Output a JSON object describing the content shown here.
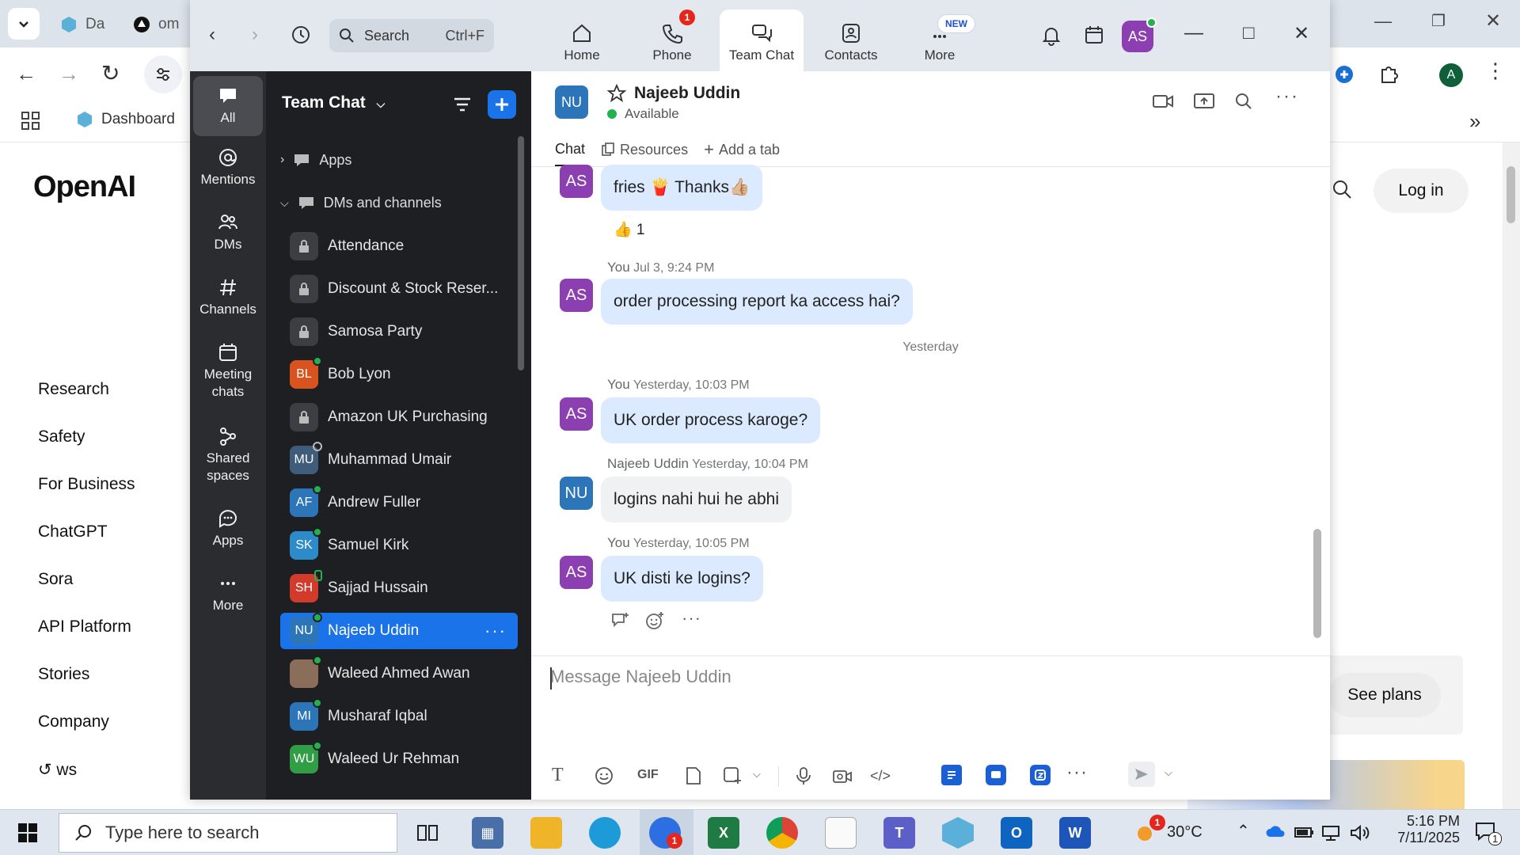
{
  "browser": {
    "tabs": [
      {
        "label": "Da"
      },
      {
        "label": "om"
      }
    ],
    "bookmarks": {
      "dashboard": "Dashboard"
    },
    "profile_initial": "A",
    "page": {
      "logo": "OpenAI",
      "nav": [
        "Research",
        "Safety",
        "For Business",
        "ChatGPT",
        "Sora",
        "API Platform",
        "Stories",
        "Company",
        "↺ ​​ws"
      ],
      "login": "Log in",
      "see_plans": "See plans"
    }
  },
  "zoom": {
    "search": {
      "placeholder": "Search",
      "shortcut": "Ctrl+F"
    },
    "tabs": [
      {
        "label": "Home",
        "icon": "home-icon"
      },
      {
        "label": "Phone",
        "icon": "phone-icon",
        "badge": "1"
      },
      {
        "label": "Team Chat",
        "icon": "chat-icon",
        "active": true
      },
      {
        "label": "Contacts",
        "icon": "contacts-icon"
      },
      {
        "label": "More",
        "icon": "more-icon",
        "badge": "NEW"
      }
    ],
    "user_initials": "AS",
    "rail": [
      {
        "label": "All",
        "icon": "chat-bubble-icon"
      },
      {
        "label": "Mentions",
        "icon": "at-icon"
      },
      {
        "label": "DMs",
        "icon": "people-icon"
      },
      {
        "label": "Channels",
        "icon": "hash-icon"
      },
      {
        "label": "Meeting chats",
        "icon": "calendar-icon"
      },
      {
        "label": "Shared spaces",
        "icon": "shared-spaces-icon"
      },
      {
        "label": "Apps",
        "icon": "apps-icon"
      },
      {
        "label": "More",
        "icon": "ellipsis-icon"
      }
    ],
    "channel_list": {
      "title": "Team Chat",
      "sections": {
        "apps": "Apps",
        "dms": "DMs and channels"
      },
      "items": [
        {
          "name": "Attendance",
          "type": "lock"
        },
        {
          "name": "Discount & Stock Reser...",
          "type": "lock"
        },
        {
          "name": "Samosa Party",
          "type": "lock"
        },
        {
          "name": "Bob Lyon",
          "initials": "BL",
          "color": "#d9531e",
          "status": "online"
        },
        {
          "name": "Amazon UK Purchasing",
          "type": "lock"
        },
        {
          "name": "Muhammad Umair",
          "initials": "MU",
          "color": "#3f5c7a",
          "status": "away"
        },
        {
          "name": "Andrew Fuller",
          "initials": "AF",
          "color": "#2d75b9",
          "status": "online"
        },
        {
          "name": "Samuel Kirk",
          "initials": "SK",
          "color": "#2d8bc9",
          "status": "online"
        },
        {
          "name": "Sajjad Hussain",
          "initials": "SH",
          "color": "#d23a2c",
          "status": "mobile"
        },
        {
          "name": "Najeeb Uddin",
          "initials": "NU",
          "color": "#2d75b9",
          "status": "online",
          "active": true
        },
        {
          "name": "Waleed Ahmed Awan",
          "initials": "",
          "color": "#8a6e5a",
          "status": "online"
        },
        {
          "name": "Musharaf Iqbal",
          "initials": "MI",
          "color": "#2d75b9",
          "status": "online"
        },
        {
          "name": "Waleed Ur Rehman",
          "initials": "WU",
          "color": "#2f9e44",
          "status": "online"
        }
      ]
    },
    "chat": {
      "contact_name": "Najeeb Uddin",
      "contact_initials": "NU",
      "status": "Available",
      "tabs": [
        "Chat",
        "Resources",
        "Add a tab"
      ],
      "day_separator": "Yesterday",
      "messages": [
        {
          "from": "AS",
          "text": "fries 🍟 Thanks👍🏼",
          "reaction": "👍 1"
        },
        {
          "from": "AS",
          "sender": "You",
          "time": "Jul 3, 9:24 PM",
          "text": "order processing report ka access hai?"
        },
        {
          "from": "AS",
          "sender": "You",
          "time": "Yesterday, 10:03 PM",
          "text": "UK order process karoge?"
        },
        {
          "from": "NU",
          "sender": "Najeeb Uddin",
          "time": "Yesterday, 10:04 PM",
          "text": "logins nahi hui he abhi"
        },
        {
          "from": "AS",
          "sender": "You",
          "time": "Yesterday, 10:05 PM",
          "text": "UK disti ke logins?"
        }
      ],
      "composer_placeholder": "Message Najeeb Uddin"
    }
  },
  "taskbar": {
    "search_placeholder": "Type here to search",
    "weather": "30°C",
    "weather_badge": "1",
    "zoom_badge": "1",
    "time": "5:16 PM",
    "date": "7/11/2025",
    "notification_count": "1"
  }
}
